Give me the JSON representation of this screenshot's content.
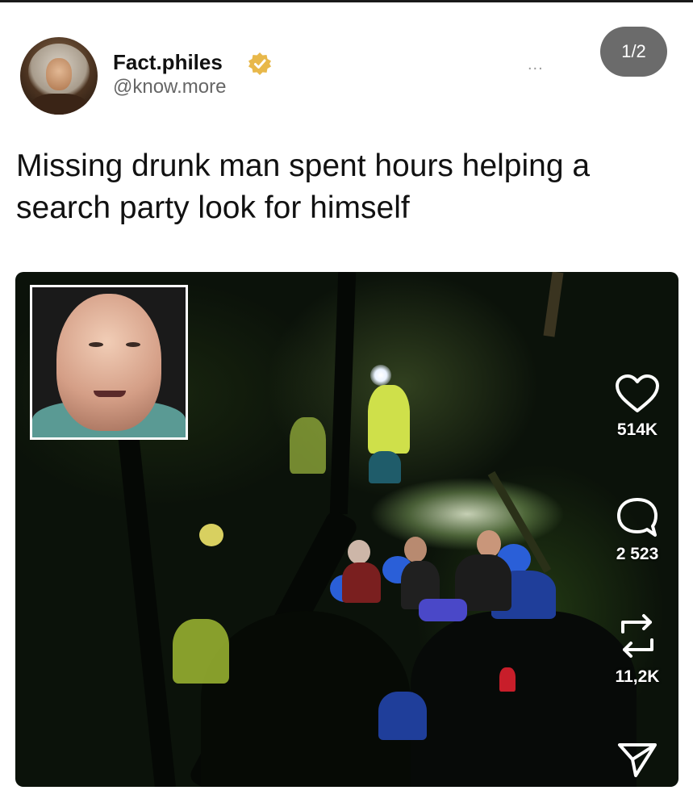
{
  "post": {
    "author_name": "Fact.philes",
    "author_handle": "@know.more",
    "more_menu": "...",
    "page_indicator": "1/2",
    "caption": "Missing drunk man spent hours helping a search party look for himself"
  },
  "actions": {
    "likes": "514K",
    "comments": "2 523",
    "reposts": "11,2K"
  },
  "colors": {
    "verified_badge": "#e8b84a",
    "pager_background": "#6b6b6b"
  },
  "icons": [
    "verified-badge-icon",
    "heart-icon",
    "comment-icon",
    "repost-icon",
    "share-icon"
  ]
}
